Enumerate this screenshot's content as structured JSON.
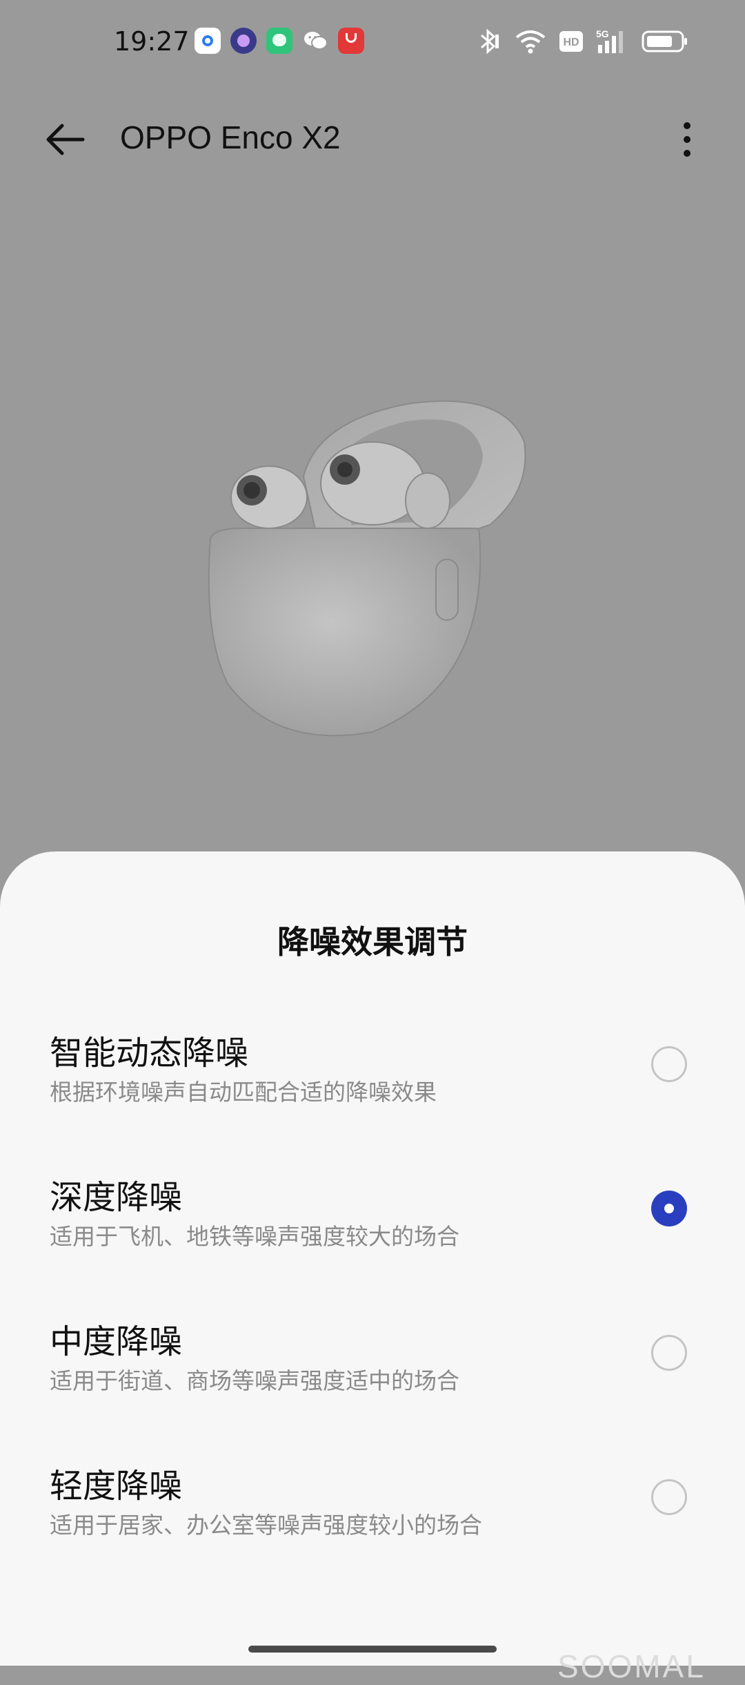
{
  "status_bar": {
    "time": "19:27",
    "notification_icons": [
      "app-icon-blue-ring",
      "app-icon-purple",
      "messages-icon",
      "wechat-icon",
      "shopping-bag-icon"
    ],
    "system_icons": [
      "bluetooth-icon",
      "wifi-icon",
      "hd-icon",
      "signal-5g-icon",
      "battery-icon"
    ],
    "hd_label": "HD",
    "network_label": "5G"
  },
  "app_bar": {
    "title": "OPPO Enco X2"
  },
  "sheet": {
    "title": "降噪效果调节",
    "options": [
      {
        "title": "智能动态降噪",
        "description": "根据环境噪声自动匹配合适的降噪效果",
        "selected": false
      },
      {
        "title": "深度降噪",
        "description": "适用于飞机、地铁等噪声强度较大的场合",
        "selected": true
      },
      {
        "title": "中度降噪",
        "description": "适用于街道、商场等噪声强度适中的场合",
        "selected": false
      },
      {
        "title": "轻度降噪",
        "description": "适用于居家、办公室等噪声强度较小的场合",
        "selected": false
      }
    ]
  },
  "watermark": "SOOMAL",
  "colors": {
    "accent": "#2a3fbf",
    "scrim": "#9a9a9a",
    "sheet_background": "#f7f7f7"
  }
}
